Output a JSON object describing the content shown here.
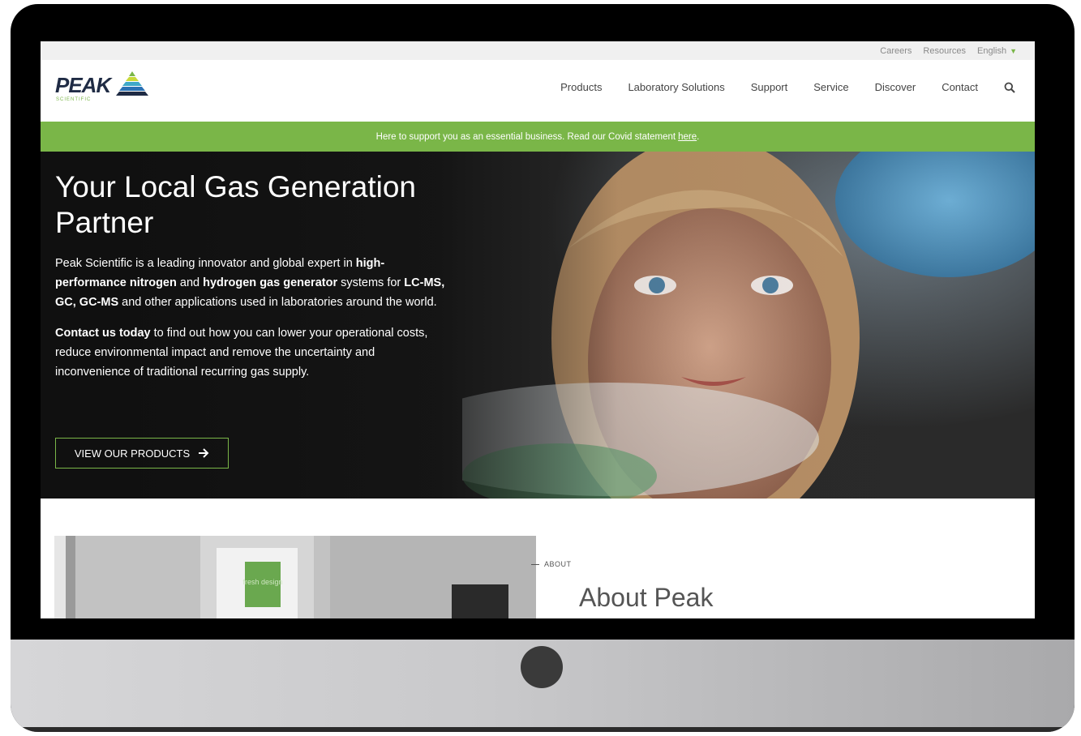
{
  "utility_nav": {
    "items": [
      "Careers",
      "Resources"
    ],
    "language": "English"
  },
  "brand": {
    "name": "PEAK",
    "sub": "SCIENTIFIC"
  },
  "main_nav": {
    "items": [
      "Products",
      "Laboratory Solutions",
      "Support",
      "Service",
      "Discover",
      "Contact"
    ],
    "search_icon": "search-icon"
  },
  "banner": {
    "text": "Here to support you as an essential business. Read our Covid statement",
    "link": "here",
    "suffix": "."
  },
  "hero": {
    "title": "Your Local Gas Generation Partner",
    "p1": {
      "t1": "Peak Scientific is a leading innovator and global expert in ",
      "b1": "high-performance nitrogen",
      "t2": " and ",
      "b2": "hydrogen gas generator",
      "t3": " systems for ",
      "b3": "LC-MS, GC, GC-MS",
      "t4": " and other applications used in laboratories around the world."
    },
    "p2": {
      "b1": "Contact us today",
      "t1": " to find out how you can lower your operational costs, reduce environmental impact and remove the uncertainty and inconvenience of traditional recurring gas supply."
    },
    "button": "VIEW OUR PRODUCTS",
    "button_icon": "arrow-right-icon"
  },
  "about": {
    "label": "ABOUT",
    "title": "About Peak",
    "sign_text": "fresh design"
  },
  "colors": {
    "accent_green": "#7ab648",
    "brand_navy": "#1f2b44"
  }
}
